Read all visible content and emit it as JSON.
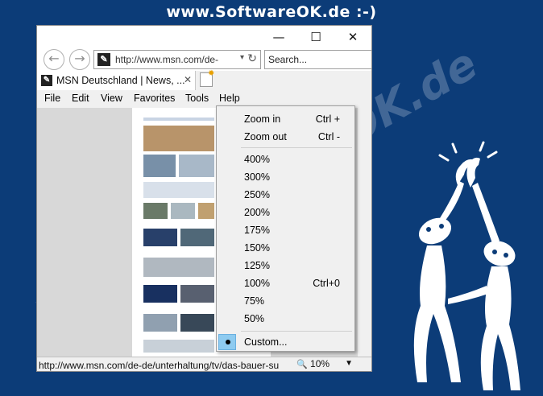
{
  "banner": "www.SoftwareOK.de :-)",
  "watermark": "www.SoftwareOK.de",
  "window": {
    "controls": {
      "minimize": "—",
      "maximize": "☐",
      "close": "✕"
    },
    "nav": {
      "back_glyph": "←",
      "forward_glyph": "→",
      "address": "http://www.msn.com/de-",
      "dropdown_glyph": "▾",
      "refresh_glyph": "↻",
      "search_placeholder": "Search..."
    },
    "tab": {
      "title": "MSN Deutschland | News, ...",
      "close_glyph": "✕"
    },
    "menubar": [
      "File",
      "Edit",
      "View",
      "Favorites",
      "Tools",
      "Help"
    ],
    "status": {
      "url": "http://www.msn.com/de-de/unterhaltung/tv/das-bauer-su",
      "zoom": "10%",
      "zoom_icon": "magnifier-icon"
    }
  },
  "zoom_menu": {
    "zoom_in": {
      "label": "Zoom in",
      "shortcut": "Ctrl +"
    },
    "zoom_out": {
      "label": "Zoom out",
      "shortcut": "Ctrl -"
    },
    "levels": [
      {
        "label": "400%",
        "shortcut": ""
      },
      {
        "label": "300%",
        "shortcut": ""
      },
      {
        "label": "250%",
        "shortcut": ""
      },
      {
        "label": "200%",
        "shortcut": ""
      },
      {
        "label": "175%",
        "shortcut": ""
      },
      {
        "label": "150%",
        "shortcut": ""
      },
      {
        "label": "125%",
        "shortcut": ""
      },
      {
        "label": "100%",
        "shortcut": "Ctrl+0"
      },
      {
        "label": "75%",
        "shortcut": ""
      },
      {
        "label": "50%",
        "shortcut": ""
      }
    ],
    "custom": {
      "label": "Custom...",
      "checked": true
    }
  },
  "colors": {
    "background": "#0c3c78",
    "check_highlight": "#8ecbf0"
  }
}
